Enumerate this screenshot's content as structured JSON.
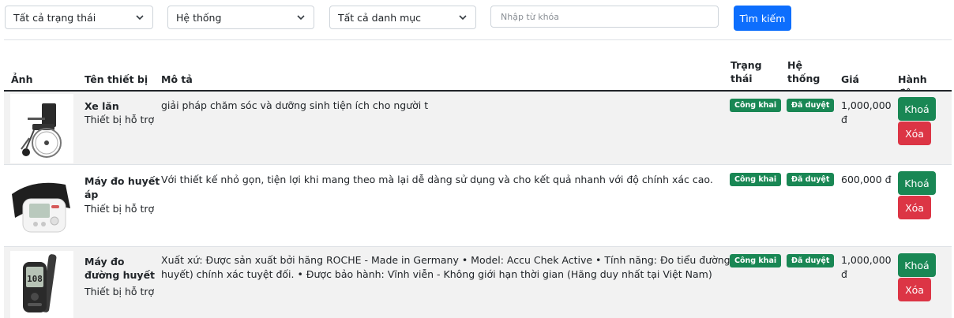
{
  "filters": {
    "status": "Tất cả trạng thái",
    "system": "Hệ thống",
    "category": "Tất cả danh mục",
    "search_placeholder": "Nhập từ khóa",
    "search_button": "Tìm kiếm"
  },
  "table": {
    "headers": {
      "image": "Ảnh",
      "name": "Tên thiết bị",
      "description": "Mô tả",
      "status_line1": "Trạng",
      "status_line2": "thái",
      "system_line1": "Hệ",
      "system_line2": "thống",
      "price": "Giá",
      "actions": "Hành động"
    },
    "rows": [
      {
        "name": "Xe lăn",
        "category": "Thiết bị hỗ trợ",
        "description": "giải pháp chăm sóc và dưỡng sinh tiện ích cho người t",
        "status": "Công khai",
        "system": "Đã duyệt",
        "price_line1": "1,000,000",
        "price_line2": "đ",
        "lock": "Khoá",
        "delete": "Xóa",
        "image_icon": "wheelchair-photo"
      },
      {
        "name_line1": "Máy đo huyết",
        "name_line2": "áp",
        "category": "Thiết bị hỗ trợ",
        "description": "Với thiết kế nhỏ gọn, tiện lợi khi mang theo mà lại dễ dàng sử dụng và cho kết quả nhanh với độ chính xác cao.",
        "status": "Công khai",
        "system": "Đã duyệt",
        "price": "600,000 đ",
        "lock": "Khoá",
        "delete": "Xóa",
        "image_icon": "blood-pressure-monitor-photo"
      },
      {
        "name_line1": "Máy đo",
        "name_line2": "đường huyết",
        "category": "Thiết bị hỗ trợ",
        "description_line1": "Xuất xứ: Được sản xuất bởi hãng ROCHE - Made in Germany • Model: Accu Chek Active • Tính năng: Đo tiểu đường (đường",
        "description_line2": "huyết) chính xác tuyệt đối. • Được bảo hành: Vĩnh viễn - Không giới hạn thời gian (Hãng duy nhất tại Việt Nam)",
        "status": "Công khai",
        "system": "Đã duyệt",
        "price_line1": "1,000,000",
        "price_line2": "đ",
        "lock": "Khoá",
        "delete": "Xóa",
        "meter_reading": "108",
        "image_icon": "glucose-meter-photo"
      }
    ]
  }
}
